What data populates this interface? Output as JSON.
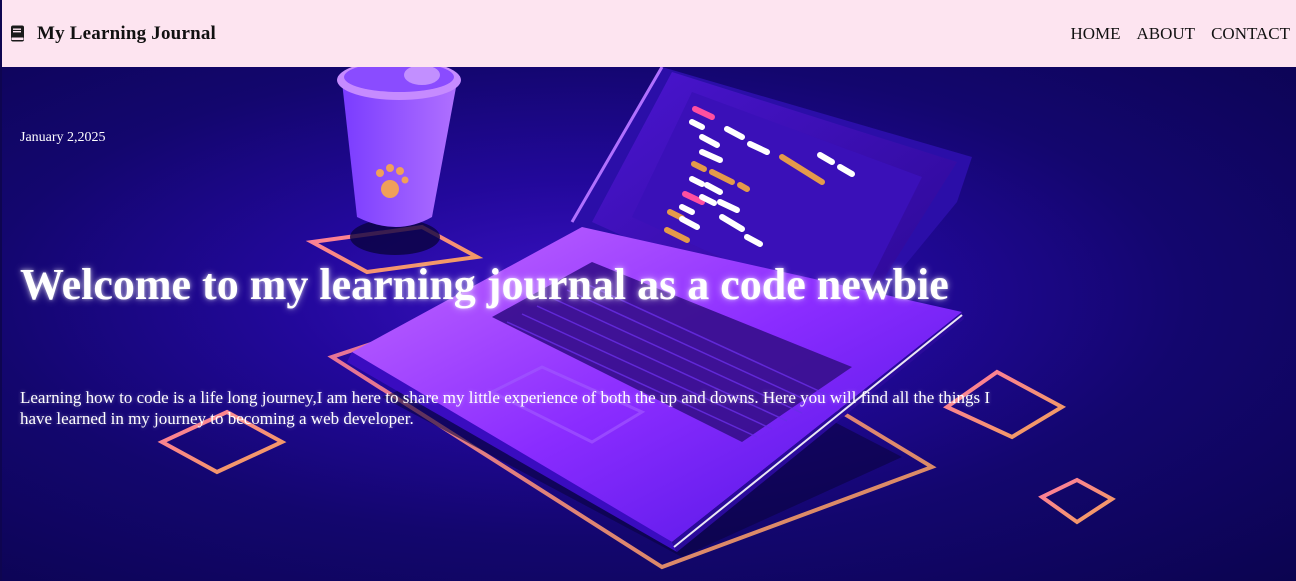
{
  "header": {
    "brand_title": "My Learning Journal",
    "brand_icon": "book-icon"
  },
  "nav": {
    "items": [
      {
        "label": "HOME"
      },
      {
        "label": "ABOUT"
      },
      {
        "label": "CONTACT"
      }
    ]
  },
  "hero": {
    "date": "January 2,2025",
    "headline": "Welcome to my learning journal as a code newbie",
    "intro": "Learning how to code is a life long journey,I am here to share my little experience of both the up and downs. Here you will find all the things I have learned in my journey to becoming a web developer.",
    "illustration": "isometric-laptop-with-coffee-cup"
  },
  "colors": {
    "header_bg": "#fde4f0",
    "hero_bg": "#13066e",
    "accent_purple": "#7b2cff",
    "accent_pink": "#ff6fa8",
    "accent_orange": "#f5a05a",
    "text_light": "#ffffff"
  }
}
